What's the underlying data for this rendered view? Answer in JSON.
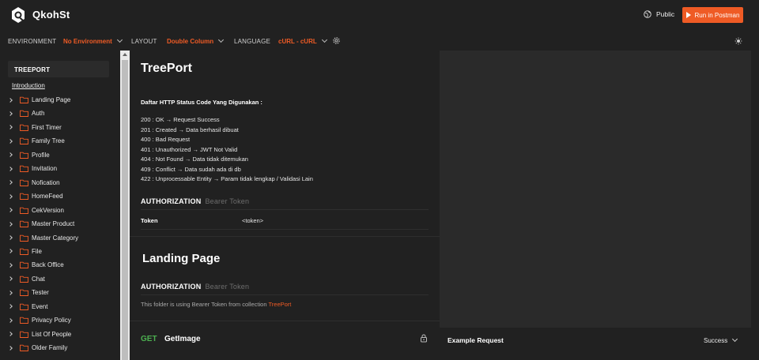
{
  "app": {
    "title": "QkohSt"
  },
  "header": {
    "visibility": "Public",
    "run_button": "Run in Postman"
  },
  "toolbar": {
    "environment_label": "ENVIRONMENT",
    "environment_value": "No Environment",
    "layout_label": "LAYOUT",
    "layout_value": "Double Column",
    "language_label": "LANGUAGE",
    "language_value": "cURL - cURL"
  },
  "sidebar": {
    "heading": "TREEPORT",
    "intro": "Introduction",
    "items": [
      {
        "label": "Landing Page"
      },
      {
        "label": "Auth"
      },
      {
        "label": "First Timer"
      },
      {
        "label": "Family Tree"
      },
      {
        "label": "Profile"
      },
      {
        "label": "Invitation"
      },
      {
        "label": "Nofication"
      },
      {
        "label": "HomeFeed"
      },
      {
        "label": "CekVersion"
      },
      {
        "label": "Master Product"
      },
      {
        "label": "Master Category"
      },
      {
        "label": "File"
      },
      {
        "label": "Back Office"
      },
      {
        "label": "Chat"
      },
      {
        "label": "Tester"
      },
      {
        "label": "Event"
      },
      {
        "label": "Privacy Policy"
      },
      {
        "label": "List Of People"
      },
      {
        "label": "Older Family"
      }
    ]
  },
  "main": {
    "title": "TreePort",
    "status_heading": "Daftar HTTP Status Code Yang Digunakan :",
    "status_codes": [
      "200 : OK → Request Success",
      "201 : Created → Data berhasil dibuat",
      "400 : Bad Request",
      "401 : Unauthorized → JWT Not Valid",
      "404 : Not Found → Data tidak ditemukan",
      "409 : Conflict → Data sudah ada di db",
      "422 : Unprocessable Entity → Param tidak lengkap / Validasi Lain"
    ],
    "auth_label": "AUTHORIZATION",
    "auth_type": "Bearer Token",
    "token_key": "Token",
    "token_value": "<token>",
    "folder_title": "Landing Page",
    "folder_auth_label": "AUTHORIZATION",
    "folder_auth_type": "Bearer Token",
    "folder_note": "This folder is using Bearer Token from collection",
    "folder_note_link": "TreePort",
    "request_method": "GET",
    "request_name": "GetImage"
  },
  "example": {
    "title": "Example Request",
    "status": "Success"
  },
  "colors": {
    "accent": "#ef5b25",
    "get_method": "#4caf50",
    "background": "#212121"
  }
}
